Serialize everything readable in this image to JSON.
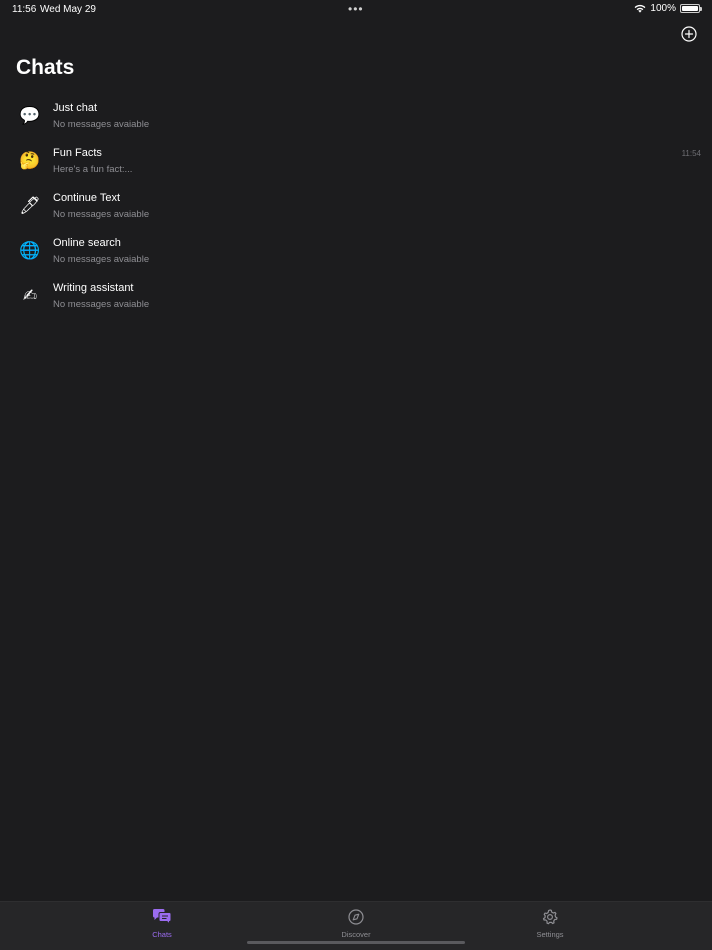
{
  "status_bar": {
    "time": "11:56",
    "date": "Wed May 29",
    "battery": "100%"
  },
  "header": {
    "title": "Chats",
    "add_icon": "plus-circle-icon"
  },
  "chats": [
    {
      "emoji": "💬",
      "icon": "speech-balloon-icon",
      "name": "Just chat",
      "preview": "No messages avaiable",
      "time": ""
    },
    {
      "emoji": "🤔",
      "icon": "thinking-face-icon",
      "name": "Fun Facts",
      "preview": "Here's a fun fact:...",
      "time": "11:54"
    },
    {
      "emoji": "🖊",
      "icon": "pen-icon",
      "name": "Continue Text",
      "preview": "No messages avaiable",
      "time": ""
    },
    {
      "emoji": "🌐",
      "icon": "globe-icon",
      "name": "Online search",
      "preview": "No messages avaiable",
      "time": ""
    },
    {
      "emoji": "✍",
      "icon": "writing-hand-icon",
      "name": "Writing assistant",
      "preview": "No messages avaiable",
      "time": ""
    }
  ],
  "tabs": [
    {
      "label": "Chats",
      "icon": "chat-bubbles-icon",
      "active": true
    },
    {
      "label": "Discover",
      "icon": "compass-icon",
      "active": false
    },
    {
      "label": "Settings",
      "icon": "gear-icon",
      "active": false
    }
  ],
  "colors": {
    "background": "#1c1c1e",
    "accent": "#9b6cf0",
    "secondary_text": "#8e8e93"
  }
}
